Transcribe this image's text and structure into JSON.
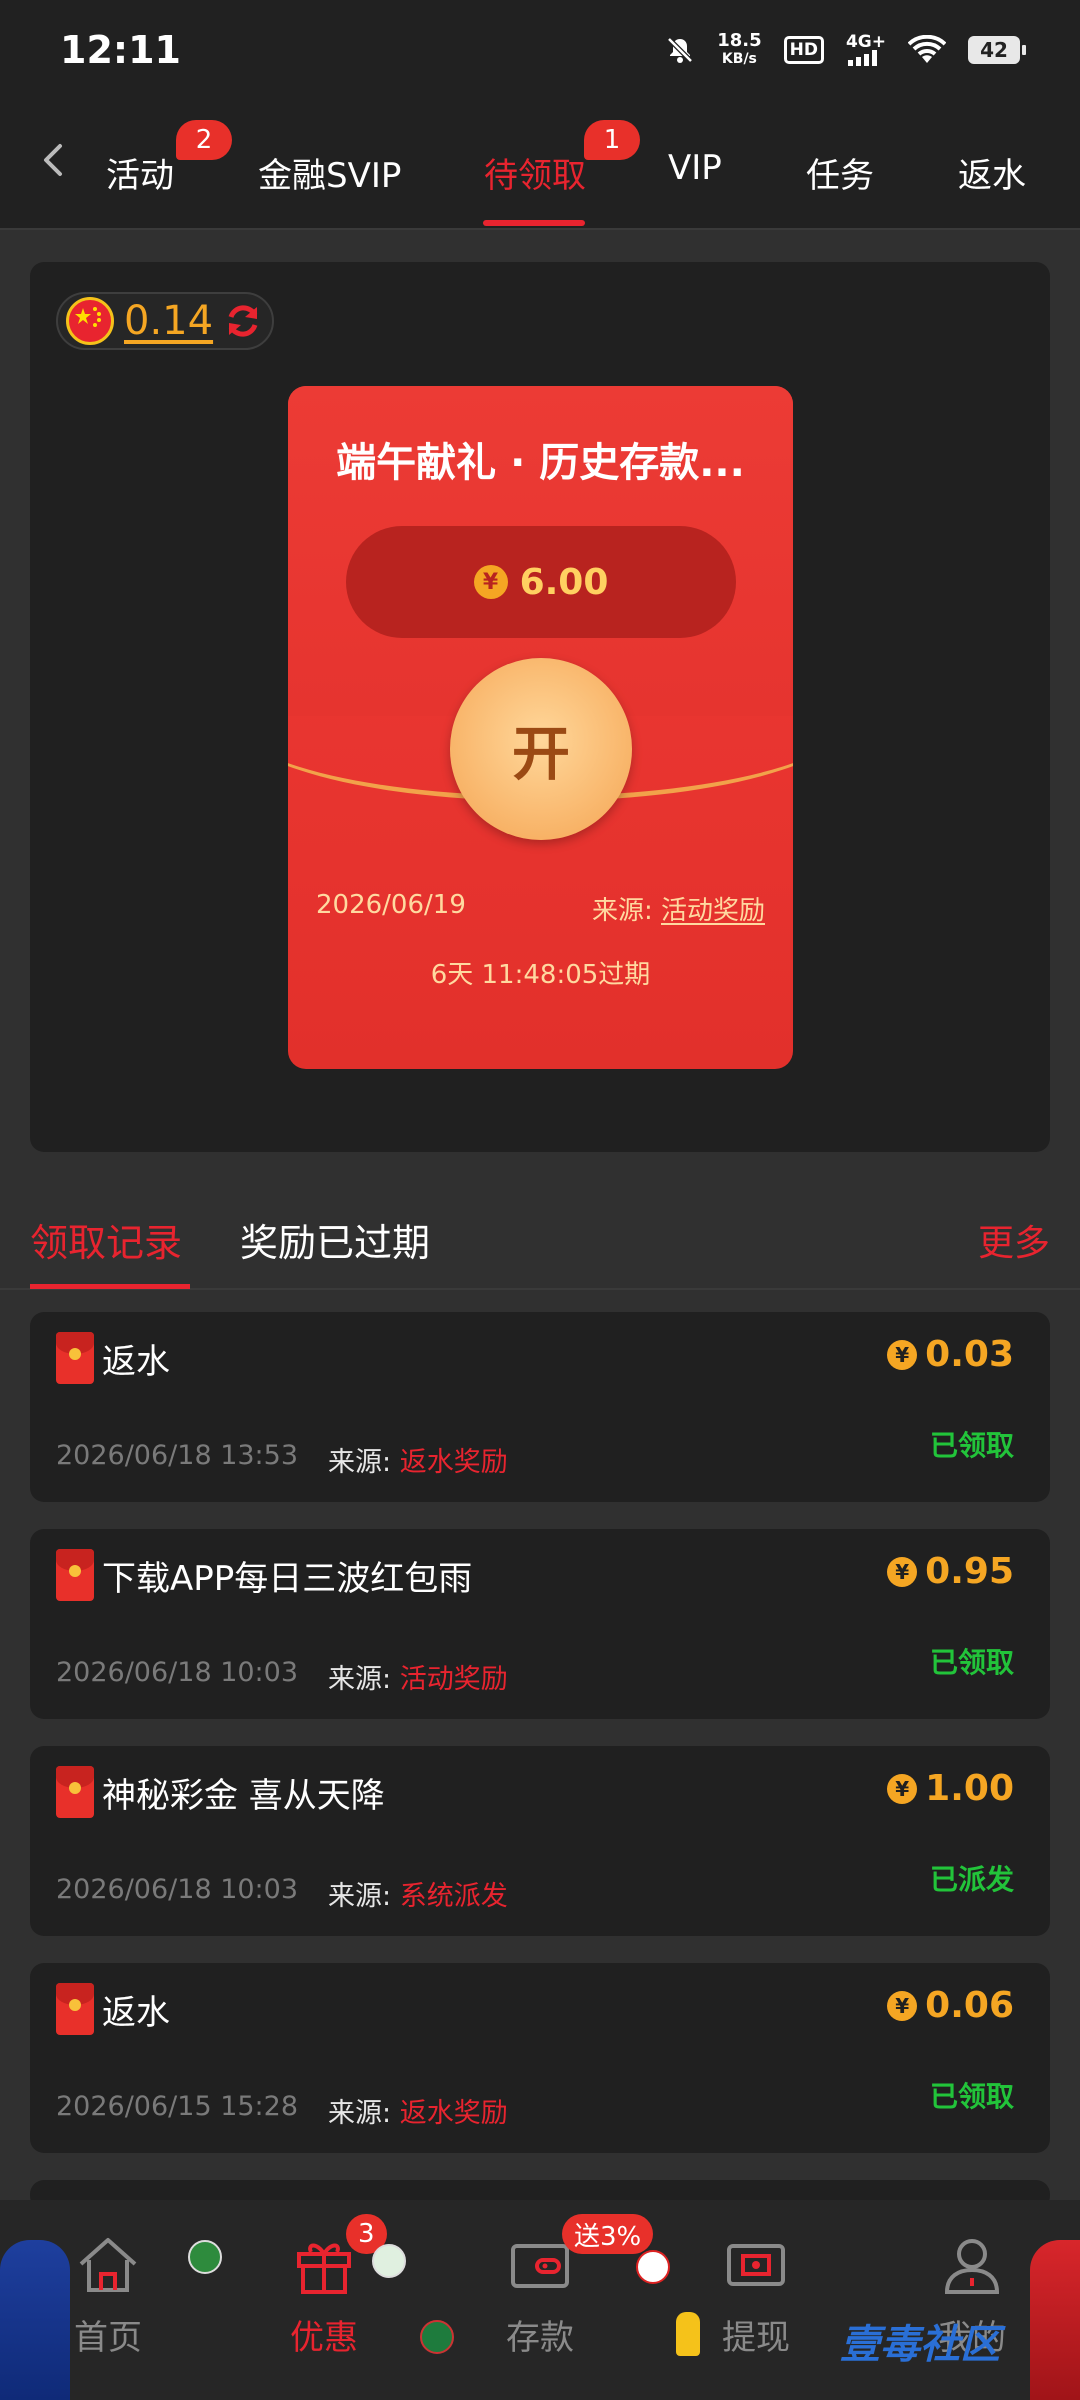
{
  "status_bar": {
    "time": "12:11",
    "speed_top": "18.5",
    "speed_bottom": "KB/s",
    "hd": "HD",
    "network": "4G+",
    "battery": "42"
  },
  "tabs": [
    {
      "label": "活动",
      "badge": "2"
    },
    {
      "label": "金融SVIP"
    },
    {
      "label": "待领取",
      "badge": "1",
      "active": true
    },
    {
      "label": "VIP"
    },
    {
      "label": "任务"
    },
    {
      "label": "返水"
    }
  ],
  "balance": {
    "amount": "0.14",
    "flag": "china-flag-icon"
  },
  "redpacket": {
    "title": "端午献礼 · 历史存款...",
    "amount": "6.00",
    "currency_symbol": "¥",
    "open_label": "开",
    "date": "2026/06/19",
    "source_label": "来源:",
    "source_value": "活动奖励",
    "expire": "6天 11:48:05过期"
  },
  "record_tabs": {
    "claimed": "领取记录",
    "expired": "奖励已过期",
    "more": "更多"
  },
  "records": [
    {
      "title": "返水",
      "amount": "0.03",
      "time": "2026/06/18 13:53",
      "source_label": "来源:",
      "source": "返水奖励",
      "status": "已领取"
    },
    {
      "title": "下载APP每日三波红包雨",
      "amount": "0.95",
      "time": "2026/06/18 10:03",
      "source_label": "来源:",
      "source": "活动奖励",
      "status": "已领取"
    },
    {
      "title": "神秘彩金 喜从天降",
      "amount": "1.00",
      "time": "2026/06/18 10:03",
      "source_label": "来源:",
      "source": "系统派发",
      "status": "已派发"
    },
    {
      "title": "返水",
      "amount": "0.06",
      "time": "2026/06/15 15:28",
      "source_label": "来源:",
      "source": "返水奖励",
      "status": "已领取"
    }
  ],
  "bottom_nav": [
    {
      "label": "首页",
      "icon": "home-icon"
    },
    {
      "label": "优惠",
      "icon": "gift-icon",
      "badge": "3",
      "active": true
    },
    {
      "label": "存款",
      "icon": "wallet-icon",
      "badge": "送3%"
    },
    {
      "label": "提现",
      "icon": "withdraw-icon"
    },
    {
      "label": "我的",
      "icon": "user-icon"
    }
  ],
  "watermark": "壹毒社区",
  "colors": {
    "accent": "#e8242f",
    "gold": "#f5a623",
    "success": "#22c43a",
    "background": "#303030",
    "card": "#202020"
  }
}
